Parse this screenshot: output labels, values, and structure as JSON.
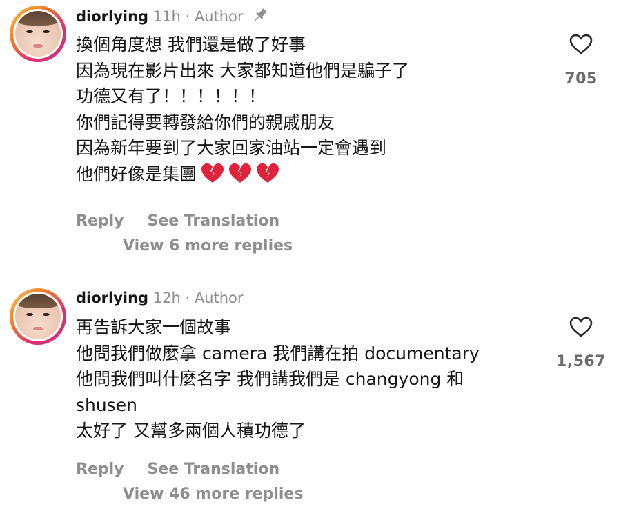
{
  "comments": [
    {
      "username": "diorlying",
      "meta": " 11h · Author",
      "pinned": true,
      "lines": [
        "換個角度想 我們還是做了好事",
        "因為現在影片出來 大家都知道他們是騙子了",
        "功德又有了！！！！！！",
        "你們記得要轉發給你們的親戚朋友",
        "因為新年要到了大家回家油站一定會遇到",
        "他們好像是集團"
      ],
      "trailing_emoji": [
        "broken-heart",
        "broken-heart",
        "broken-heart"
      ],
      "reply_label": "Reply",
      "translate_label": "See Translation",
      "view_replies": "View 6 more replies",
      "like_count": "705"
    },
    {
      "username": "diorlying",
      "meta": " 12h · Author",
      "pinned": false,
      "lines": [
        "再告訴大家一個故事",
        "他問我們做麼拿 camera 我們講在拍 documentary",
        "他問我們叫什麼名字 我們講我們是 changyong 和",
        "shusen",
        "太好了 又幫多兩個人積功德了"
      ],
      "reply_label": "Reply",
      "translate_label": "See Translation",
      "view_replies": "View 46 more replies",
      "like_count": "1,567"
    }
  ],
  "colors": {
    "text": "#161616",
    "muted": "#8e8e8e",
    "avatar_ring_start": "#f7c64a",
    "avatar_ring_end": "#c13584",
    "broken_heart": "#e0233a"
  },
  "icons": {
    "pin": "pin-icon",
    "like": "heart-outline-icon",
    "emoji": "broken-heart-emoji"
  }
}
